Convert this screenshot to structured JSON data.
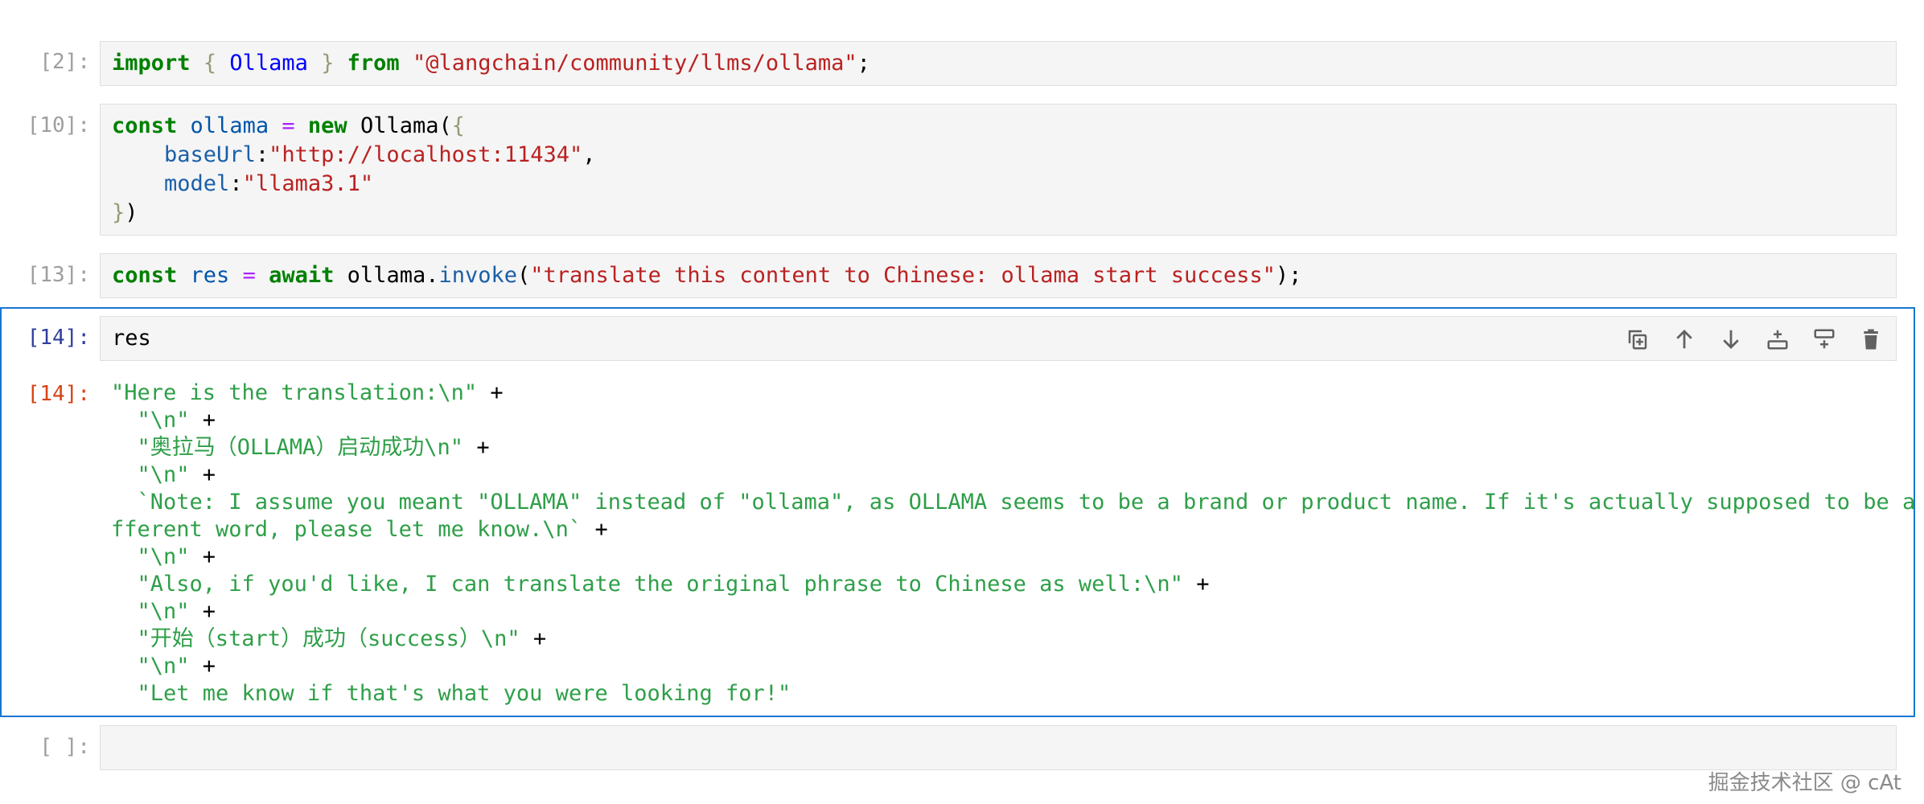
{
  "cells": [
    {
      "prompt": "[2]:"
    },
    {
      "prompt": "[10]:"
    },
    {
      "prompt": "[13]:"
    },
    {
      "prompt": "[14]:",
      "code": "res",
      "output_prompt": "[14]:"
    },
    {
      "prompt": "[ ]:"
    }
  ],
  "cell2": {
    "kw_import": "import",
    "brace_open": "{ ",
    "cls": "Ollama",
    "brace_close": " }",
    "kw_from": "from",
    "module": "\"@langchain/community/llms/ollama\"",
    "semi": ";"
  },
  "cell10": {
    "kw_const": "const",
    "var": "ollama",
    "op": "=",
    "kw_new": "new",
    "cls": "Ollama(",
    "brace_open": "{",
    "prop1": "baseUrl",
    "val1": "\"http://localhost:11434\"",
    "prop2": "model",
    "val2": "\"llama3.1\"",
    "brace_close": "}",
    "paren_close": ")"
  },
  "cell13": {
    "kw_const": "const",
    "var": "res",
    "op": "=",
    "kw_await": "await",
    "obj": "ollama.",
    "fn": "invoke",
    "arg": "\"translate this content to Chinese: ollama start success\"",
    "end": ");"
  },
  "output_lines": [
    {
      "text": "\"Here is the translation:\\n\"",
      "plus": " +"
    },
    {
      "text": "  \"\\n\"",
      "plus": " +"
    },
    {
      "text": "  \"奥拉马（OLLAMA）启动成功\\n\"",
      "plus": " +"
    },
    {
      "text": "  \"\\n\"",
      "plus": " +"
    },
    {
      "text": "  `Note: I assume you meant \"OLLAMA\" instead of \"ollama\", as OLLAMA seems to be a brand or product name. If it's actually supposed to be a di",
      "plus": ""
    },
    {
      "text": "fferent word, please let me know.\\n`",
      "plus": " +"
    },
    {
      "text": "  \"\\n\"",
      "plus": " +"
    },
    {
      "text": "  \"Also, if you'd like, I can translate the original phrase to Chinese as well:\\n\"",
      "plus": " +"
    },
    {
      "text": "  \"\\n\"",
      "plus": " +"
    },
    {
      "text": "  \"开始（start）成功（success）\\n\"",
      "plus": " +"
    },
    {
      "text": "  \"\\n\"",
      "plus": " +"
    },
    {
      "text": "  \"Let me know if that's what you were looking for!\"",
      "plus": ""
    }
  ],
  "toolbar": [
    "duplicate-icon",
    "move-up-icon",
    "move-down-icon",
    "insert-above-icon",
    "insert-below-icon",
    "delete-icon"
  ],
  "watermark": "掘金技术社区 @ cAt",
  "colors": {
    "accent": "#1976d2",
    "output_prompt": "#d84315",
    "string_output": "#2e9f48"
  }
}
